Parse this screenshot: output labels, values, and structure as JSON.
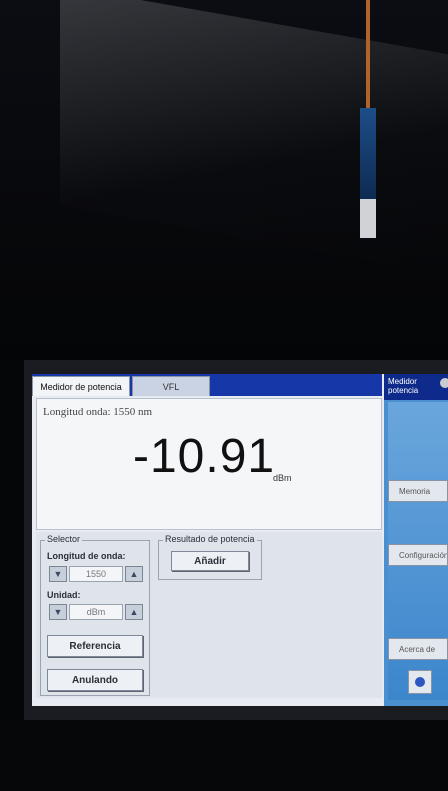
{
  "tabs": {
    "active": "Medidor de potencia",
    "vfl": "VFL"
  },
  "readout": {
    "wavelength_label": "Longitud onda: 1550 nm",
    "power_value": "-10.91",
    "power_unit": "dBm"
  },
  "selector": {
    "title": "Selector",
    "wavelength_label": "Longitud de onda:",
    "wavelength_value": "1550",
    "unit_label": "Unidad:",
    "unit_value": "dBm",
    "reference_button": "Referencia",
    "cancel_button": "Anulando"
  },
  "result": {
    "title": "Resultado de potencia",
    "add_button": "Añadir"
  },
  "sidebar": {
    "header": "Medidor potencia",
    "memory_button": "Memoria",
    "config_button": "Configuración",
    "about_button": "Acerca de"
  },
  "icons": {
    "spin_down": "down-triangle-icon",
    "spin_up": "up-triangle-icon",
    "help": "help-icon",
    "settings": "gear-icon"
  },
  "colors": {
    "tabbar": "#1537a8",
    "sidebar_header": "#0e2a8a",
    "sidebar": "#4a8fd0"
  }
}
